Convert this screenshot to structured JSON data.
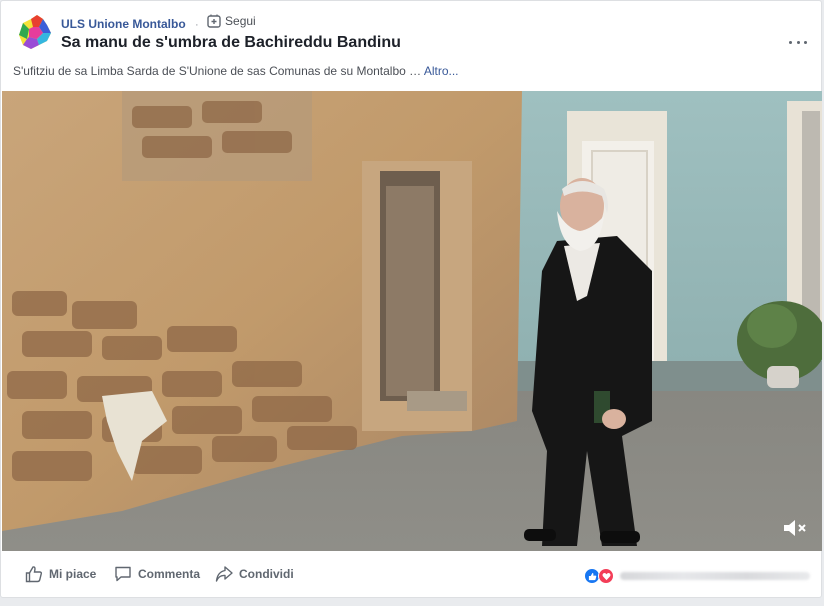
{
  "post": {
    "page_name": "ULS Unione Montalbo",
    "separator": "·",
    "follow_label": "Segui",
    "title": "Sa manu de s'umbra de Bachireddu Bandinu",
    "description": "S'ufitziu de sa Limba Sarda de S'Unione de sas Comunas de su Montalbo …",
    "see_more_label": "Altro..."
  },
  "video": {
    "muted": true
  },
  "actions": {
    "like_label": "Mi piace",
    "comment_label": "Commenta",
    "share_label": "Condividi"
  },
  "reactions": {
    "types": [
      "like",
      "love"
    ]
  },
  "colors": {
    "link": "#385898",
    "title": "#1d2129",
    "like_blue": "#1877f2",
    "love_red": "#f33e58"
  }
}
